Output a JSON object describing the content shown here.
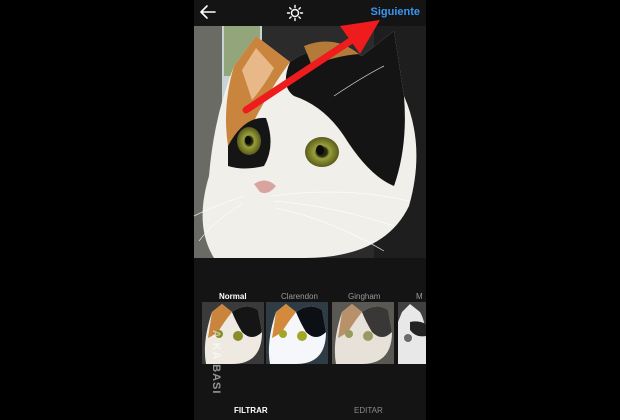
{
  "header": {
    "next_label": "Siguiente"
  },
  "filters": {
    "items": [
      {
        "label": "Normal",
        "selected": true
      },
      {
        "label": "Clarendon",
        "selected": false
      },
      {
        "label": "Gingham",
        "selected": false
      },
      {
        "label": "M",
        "selected": false
      }
    ]
  },
  "tabs": {
    "filter_label": "FILTRAR",
    "edit_label": "EDITAR"
  },
  "watermark": {
    "text": "A KA BASI"
  },
  "icons": {
    "back": "arrow-left-icon",
    "brightness": "sun-icon"
  },
  "colors": {
    "accent": "#3897f0",
    "annotation_arrow": "#ee1c1c",
    "background": "#141414"
  }
}
